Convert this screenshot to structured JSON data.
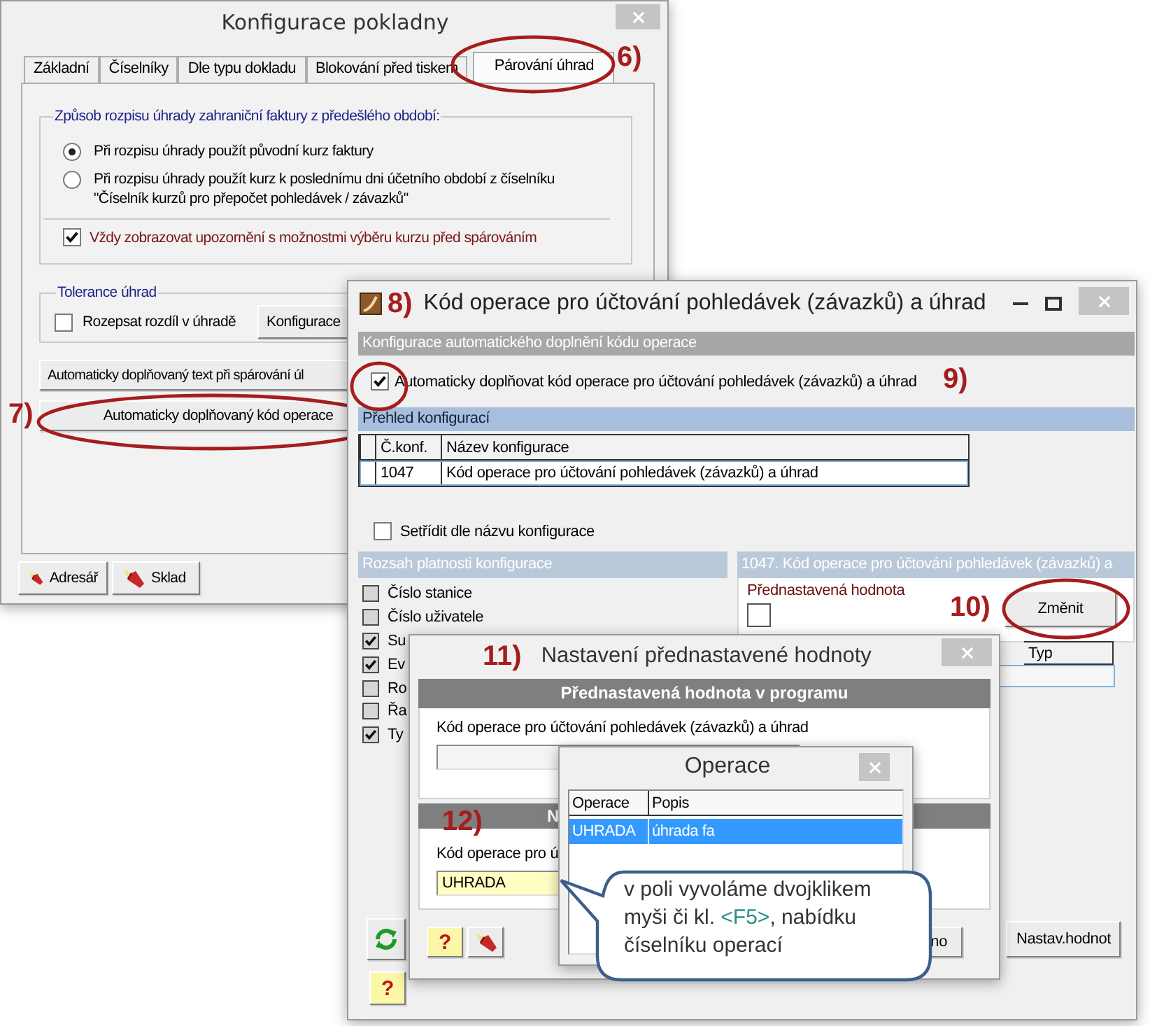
{
  "config_window": {
    "title": "Konfigurace pokladny",
    "tabs": [
      {
        "label": "Základní",
        "selected": false
      },
      {
        "label": "Číselníky",
        "selected": false
      },
      {
        "label": "Dle typu dokladu",
        "selected": false
      },
      {
        "label": "Blokování před tiskem",
        "selected": false
      },
      {
        "label": "Párování úhrad",
        "selected": true
      }
    ],
    "conversion_group": {
      "legend": "Způsob rozpisu úhrady zahraniční faktury z předešlého období:",
      "options": [
        {
          "label": "Při rozpisu úhrady použít původní kurz faktury",
          "selected": true
        },
        {
          "label": "Při rozpisu úhrady použít kurz k poslednímu dni účetního období z číselníku \"Číselník kurzů pro přepočet pohledávek / závazků\"",
          "selected": false
        }
      ],
      "warning": {
        "label": "Vždy zobrazovat upozornění s možnostmi výběru kurzu před spárováním",
        "checked": true
      }
    },
    "tolerance_group": {
      "legend": "Tolerance úhrad",
      "split": {
        "label": "Rozepsat rozdíl v úhradě",
        "checked": false
      },
      "button": "Konfigurace"
    },
    "action_buttons": [
      "Automaticky doplňovaný text při spárování úl",
      "Automaticky doplňovaný kód operace"
    ],
    "bottom_buttons": [
      "Adresář",
      "Sklad"
    ]
  },
  "code_window": {
    "step": "8)",
    "title": "Kód operace pro účtování pohledávek (závazků) a úhrad",
    "section": "Konfigurace automatického doplnění kódu operace",
    "auto_fill": {
      "label": "Automaticky doplňovat kód operace pro účtování pohledávek (závazků) a úhrad",
      "checked": true
    },
    "overview": "Přehled konfigurací",
    "table": {
      "columns": [
        "Č.konf.",
        "Název konfigurace"
      ],
      "rows": [
        [
          "1047",
          "Kód operace pro účtování pohledávek (závazků) a úhrad"
        ]
      ]
    },
    "sort": {
      "label": "Setřídit dle názvu konfigurace",
      "checked": false
    },
    "scope": {
      "title": "Rozsah platnosti konfigurace",
      "items": [
        {
          "label": "Číslo stanice",
          "checked": false
        },
        {
          "label": "Číslo uživatele",
          "checked": false
        },
        {
          "label": "Su",
          "checked": true
        },
        {
          "label": "Ev",
          "checked": true
        },
        {
          "label": "Ro",
          "checked": false
        },
        {
          "label": "Řa",
          "checked": false
        },
        {
          "label": "Ty",
          "checked": true
        }
      ]
    },
    "detail": {
      "title": "1047. Kód operace pro účtování pohledávek (závazků) a",
      "default_label": "Přednastavená hodnota",
      "default_checked": false,
      "change_button": "Změnit",
      "columns": [
        "Typ"
      ]
    },
    "help_button": "?",
    "set_button": "Nastav.hodnot"
  },
  "default_window": {
    "step": "11)",
    "title": "Nastavení přednastavené hodnoty",
    "program_header": "Přednastavená hodnota v programu",
    "program_label": "Kód operace pro účtování pohledávek (závazků) a úhrad",
    "user_header": "N",
    "user_label": "Kód operace pro ú",
    "user_value": "UHRADA",
    "help_button": "?",
    "partial_button": "no"
  },
  "operations_window": {
    "title": "Operace",
    "columns": [
      "Operace",
      "Popis"
    ],
    "rows": [
      {
        "cells": [
          "UHRADA",
          "úhrada fa"
        ],
        "selected": true
      }
    ]
  },
  "callout": {
    "before": "v poli vyvoláme dvojklikem myši či kl. ",
    "key": "<F5>",
    "after": ", nabídku číselníku operací"
  },
  "annotations": [
    "6)",
    "7)",
    "9)",
    "10)",
    "12)"
  ]
}
